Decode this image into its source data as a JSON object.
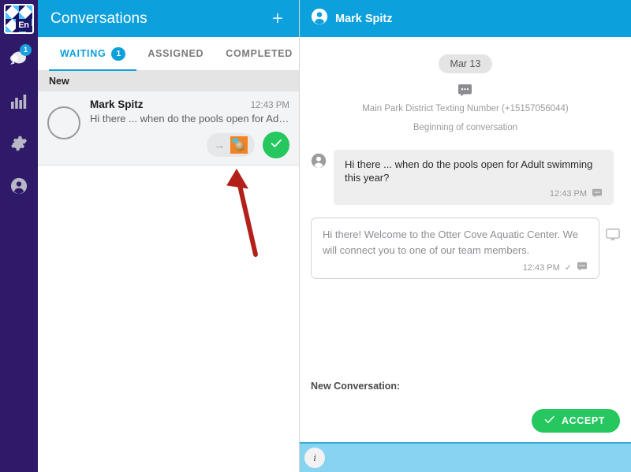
{
  "sidebar": {
    "logo_text": "En",
    "items": [
      {
        "name": "conversations",
        "icon": "chat-bubble-icon",
        "badge": "1"
      },
      {
        "name": "analytics",
        "icon": "bar-chart-icon",
        "badge": ""
      },
      {
        "name": "settings",
        "icon": "gear-icon",
        "badge": ""
      },
      {
        "name": "account",
        "icon": "user-circle-icon",
        "badge": ""
      }
    ]
  },
  "list_panel": {
    "title": "Conversations",
    "new_button_label": "+",
    "tabs": [
      {
        "label": "WAITING",
        "badge": "1",
        "active": true
      },
      {
        "label": "ASSIGNED",
        "badge": "",
        "active": false
      },
      {
        "label": "COMPLETED",
        "badge": "",
        "active": false
      }
    ],
    "group_label": "New",
    "conversation": {
      "name": "Mark Spitz",
      "time": "12:43 PM",
      "snippet": "Hi there ... when do the pools open for Adult…",
      "assign_arrow": "→",
      "accept_check": "✓"
    }
  },
  "chat_panel": {
    "header_name": "Mark Spitz",
    "date_chip": "Mar 13",
    "system_line_1": "Main Park District Texting Number (+15157056044)",
    "system_line_2": "Beginning of conversation",
    "messages": [
      {
        "direction": "inbound",
        "text": "Hi there ... when do the pools open for Adult swimming this year?",
        "time": "12:43 PM",
        "channel_icon": "sms-bubble-icon",
        "status_icon": ""
      },
      {
        "direction": "outbound",
        "text": "Hi there!  Welcome to the Otter Cove Aquatic Center.  We will connect you to one of our team members.",
        "time": "12:43 PM",
        "channel_icon": "sms-bubble-icon",
        "status_icon": "✓"
      }
    ],
    "new_conversation_label": "New Conversation:",
    "accept_button_label": "ACCEPT",
    "accept_button_check": "✓",
    "info_button_label": "i"
  },
  "colors": {
    "brand_blue": "#0ca0dd",
    "rail_purple": "#2e1a68",
    "accept_green": "#25c75e",
    "bottom_bar_blue": "#87d3f2",
    "annotation_red": "#b32019"
  }
}
